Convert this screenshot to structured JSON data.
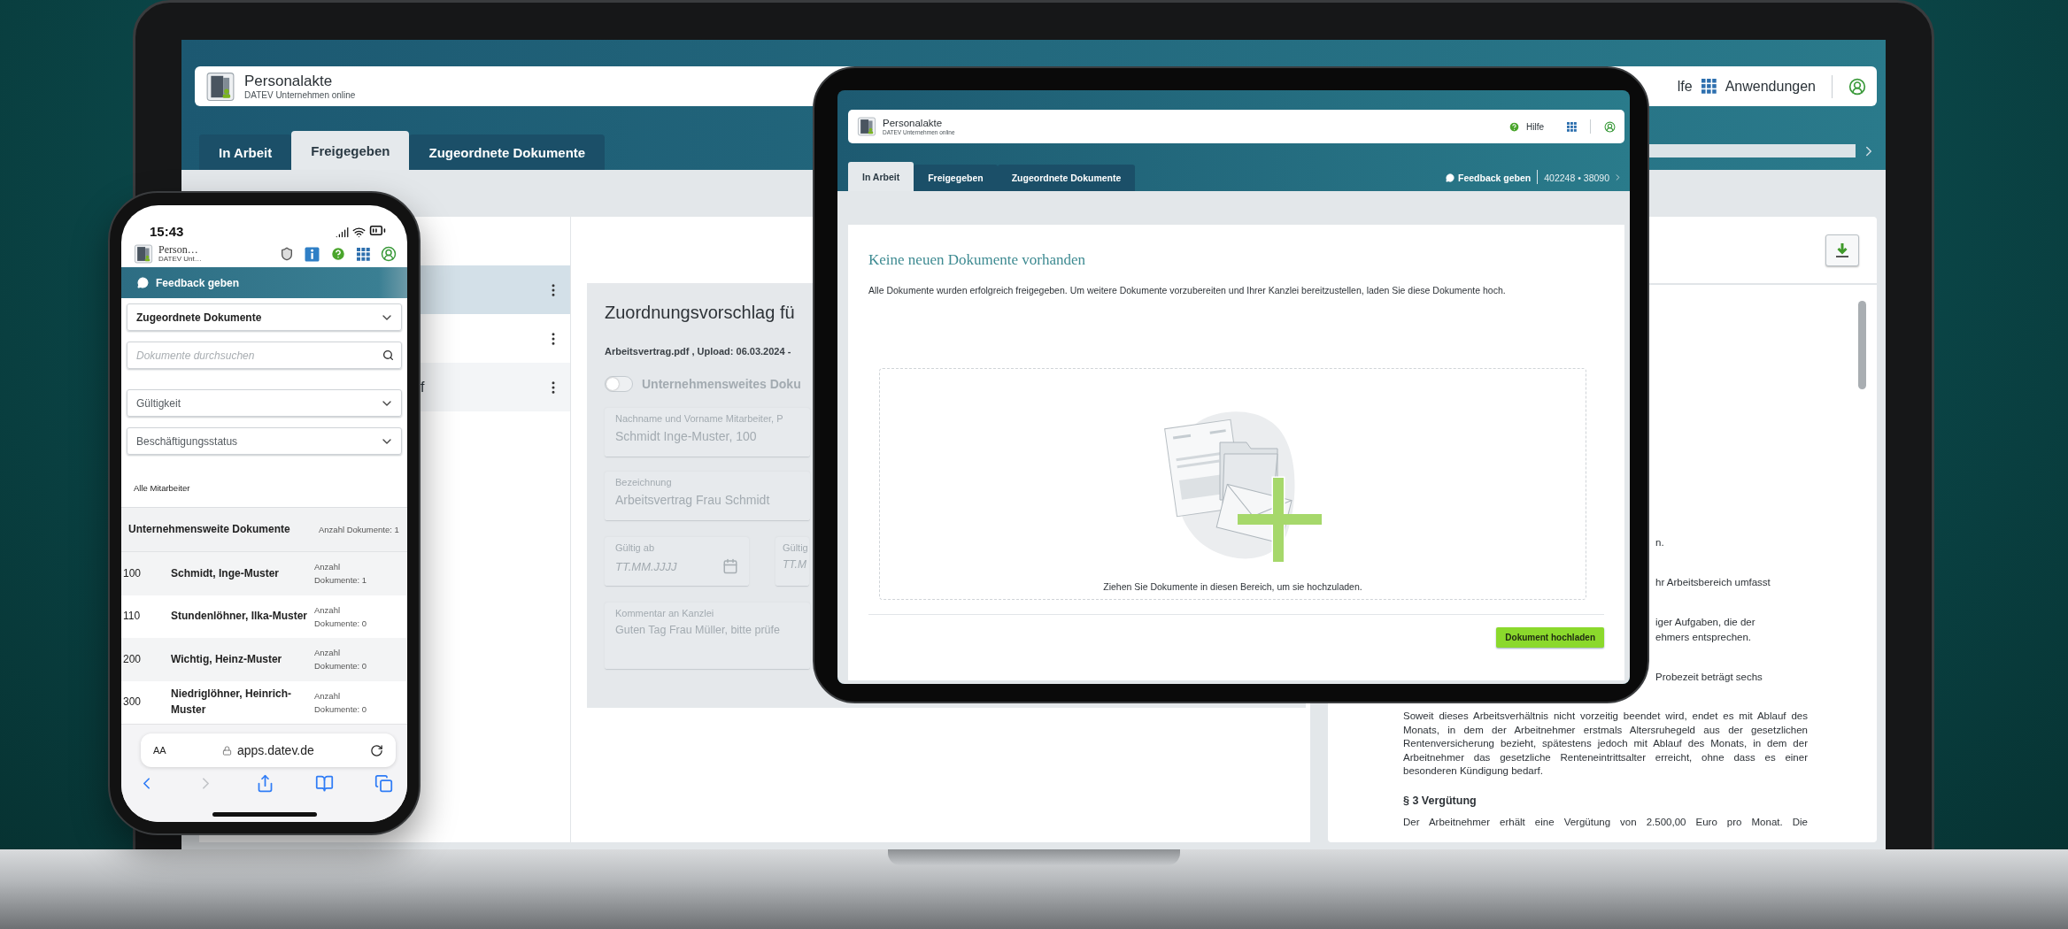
{
  "laptop": {
    "header": {
      "title": "Personalakte",
      "subtitle": "DATEV Unternehmen online",
      "help_label": "lfe",
      "apps_label": "Anwendungen"
    },
    "tabs": [
      {
        "label": "In Arbeit",
        "selected": false
      },
      {
        "label": "Freigegeben",
        "selected": true
      },
      {
        "label": "Zugeordnete Dokumente",
        "selected": false
      }
    ],
    "document_list": [
      {
        "selected": true
      },
      {
        "selected": false
      },
      {
        "label": "f",
        "selected": false
      }
    ],
    "form": {
      "disabled": true,
      "title": "Zuordnungsvorschlag fü",
      "file_info": "Arbeitsvertrag.pdf , Upload: 06.03.2024 -",
      "toggle": {
        "label": "Unternehmensweites Doku",
        "on": false
      },
      "fields": [
        {
          "label": "Nachname und Vorname Mitarbeiter, P",
          "value": "Schmidt Inge-Muster, 100"
        },
        {
          "label": "Bezeichnung",
          "value": "Arbeitsvertrag Frau Schmidt"
        }
      ],
      "date_fields": [
        {
          "label": "Gültig ab",
          "placeholder": "TT.MM.JJJJ"
        },
        {
          "label": "Gültig",
          "placeholder": "TT.M"
        }
      ],
      "comment": {
        "label": "Kommentar an Kanzlei",
        "value": "Guten Tag Frau Müller, bitte prüfe"
      }
    },
    "document_viewer": {
      "fragments": [
        [
          "n."
        ],
        [
          "hr Arbeitsbereich umfasst"
        ],
        [
          "iger Aufgaben, die der",
          "ehmers entsprechen."
        ],
        [
          "Probezeit beträgt sechs"
        ]
      ],
      "paragraph": "Soweit dieses Arbeitsverhältnis nicht vorzeitig beendet wird, endet es mit Ablauf des Monats, in dem der Arbeitnehmer erstmals Altersruhegeld aus der gesetzlichen Rentenversicherung bezieht, spätestens jedoch mit Ablauf des Monats, in dem der Arbeitnehmer das gesetzliche Renteneintrittsalter erreicht, ohne dass es einer besonderen Kündigung bedarf.",
      "section_heading": "§ 3 Vergütung",
      "last_line": "Der Arbeitnehmer erhält eine Vergütung von 2.500,00 Euro pro Monat. Die"
    }
  },
  "tablet": {
    "header": {
      "title": "Personalakte",
      "subtitle": "DATEV Unternehmen online",
      "help_label": "Hilfe"
    },
    "tabs": [
      {
        "label": "In Arbeit",
        "selected": true
      },
      {
        "label": "Freigegeben",
        "selected": false
      },
      {
        "label": "Zugeordnete Dokumente",
        "selected": false
      }
    ],
    "feedback_label": "Feedback geben",
    "account": "402248 • 38090",
    "heading": "Keine neuen Dokumente vorhanden",
    "message": "Alle Dokumente wurden erfolgreich freigegeben. Um weitere Dokumente vorzubereiten und Ihrer Kanzlei bereitzustellen, laden Sie diese Dokumente hoch.",
    "drop_hint": "Ziehen Sie Dokumente in diesen Bereich, um sie hochzuladen.",
    "upload_button": "Dokument hochladen"
  },
  "phone": {
    "time": "15:43",
    "header": {
      "title": "Person…",
      "subtitle": "DATEV Unt…"
    },
    "feedback_label": "Feedback geben",
    "filters": [
      {
        "kind": "select",
        "value": "Zugeordnete Dokumente"
      },
      {
        "kind": "search",
        "placeholder": "Dokumente durchsuchen"
      },
      {
        "kind": "select",
        "placeholder": "Gültigkeit"
      },
      {
        "kind": "select",
        "placeholder": "Beschäftigungsstatus"
      }
    ],
    "list_caption": "Alle Mitarbeiter",
    "table_header": {
      "title": "Unternehmensweite Dokumente",
      "count": "Anzahl Dokumente: 1"
    },
    "rows": [
      {
        "number": "100",
        "name": "Schmidt, Inge-Muster",
        "count": "Anzahl Dokumente: 1"
      },
      {
        "number": "110",
        "name": "Stundenlöhner, Ilka-Muster",
        "count": "Anzahl Dokumente: 0"
      },
      {
        "number": "200",
        "name": "Wichtig, Heinz-Muster",
        "count": "Anzahl Dokumente: 0"
      },
      {
        "number": "300",
        "name": "Niedriglöhner, Heinrich-Muster",
        "count": "Anzahl Dokumente: 0"
      }
    ],
    "browser": {
      "text_size": "AA",
      "url": "apps.datev.de",
      "toolbar": [
        {
          "kind": "back",
          "disabled": false
        },
        {
          "kind": "forward",
          "disabled": true
        },
        {
          "kind": "share",
          "disabled": false
        },
        {
          "kind": "bookmarks",
          "disabled": false
        },
        {
          "kind": "tabs",
          "disabled": false
        }
      ]
    }
  }
}
